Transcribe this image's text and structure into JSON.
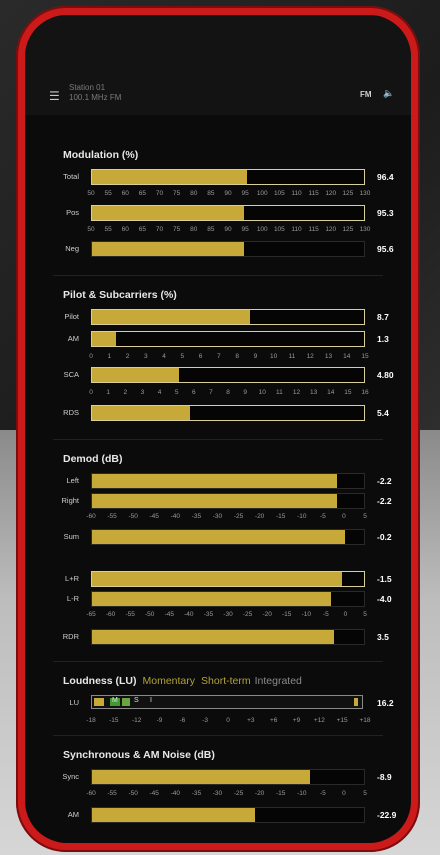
{
  "status": {
    "station_line1": "Station 01",
    "station_line2": "100.1 MHz FM",
    "mode": "FM"
  },
  "sections": {
    "modulation": {
      "title": "Modulation (%)",
      "rows": [
        {
          "label": "Total",
          "value": "96.4",
          "fraction": 0.57
        },
        {
          "label": "Pos",
          "value": "95.3",
          "fraction": 0.56
        },
        {
          "label": "Neg",
          "value": "95.6",
          "fraction": 0.56
        }
      ],
      "scale": [
        "50",
        "55",
        "60",
        "65",
        "70",
        "75",
        "80",
        "85",
        "90",
        "95",
        "100",
        "105",
        "110",
        "115",
        "120",
        "125",
        "130"
      ]
    },
    "pilot": {
      "title": "Pilot & Subcarriers (%)",
      "rows": [
        {
          "label": "Pilot",
          "value": "8.7",
          "fraction": 0.58
        },
        {
          "label": "AM",
          "value": "1.3",
          "fraction": 0.09
        }
      ],
      "scale_a": [
        "0",
        "1",
        "2",
        "3",
        "4",
        "5",
        "6",
        "7",
        "8",
        "9",
        "10",
        "11",
        "12",
        "13",
        "14",
        "15"
      ],
      "rows_b": [
        {
          "label": "SCA",
          "value": "4.80",
          "fraction": 0.32
        }
      ],
      "scale_b": [
        "0",
        "1",
        "2",
        "3",
        "4",
        "5",
        "6",
        "7",
        "8",
        "9",
        "10",
        "11",
        "12",
        "13",
        "14",
        "15",
        "16"
      ],
      "rows_c": [
        {
          "label": "RDS",
          "value": "5.4",
          "fraction": 0.36
        }
      ]
    },
    "demod": {
      "title": "Demod (dB)",
      "rows_a": [
        {
          "label": "Left",
          "value": "-2.2",
          "fraction": 0.9
        },
        {
          "label": "Right",
          "value": "-2.2",
          "fraction": 0.9
        }
      ],
      "scale_a": [
        "-60",
        "-55",
        "-50",
        "-45",
        "-40",
        "-35",
        "-30",
        "-25",
        "-20",
        "-15",
        "-10",
        "-5",
        "0",
        "5"
      ],
      "rows_b": [
        {
          "label": "Sum",
          "value": "-0.2",
          "fraction": 0.93
        }
      ],
      "rows_c": [
        {
          "label": "L+R",
          "value": "-1.5",
          "fraction": 0.92
        },
        {
          "label": "L-R",
          "value": "-4.0",
          "fraction": 0.88
        }
      ],
      "scale_c": [
        "-65",
        "-60",
        "-55",
        "-50",
        "-45",
        "-40",
        "-35",
        "-30",
        "-25",
        "-20",
        "-15",
        "-10",
        "-5",
        "0",
        "5"
      ],
      "rows_d": [
        {
          "label": "RDR",
          "value": "3.5",
          "fraction": 0.89
        }
      ]
    },
    "loudness": {
      "title": "Loudness (LU)",
      "sub_momentary": "Momentary",
      "sub_shortterm": "Short-term",
      "sub_integrated": "Integrated",
      "row": {
        "label": "LU",
        "value": "16.2",
        "m_label": "M",
        "s_label": "S",
        "i_label": "I"
      },
      "scale": [
        "-18",
        "-15",
        "-12",
        "-9",
        "-6",
        "-3",
        "0",
        "+3",
        "+6",
        "+9",
        "+12",
        "+15",
        "+18"
      ]
    },
    "noise": {
      "title": "Synchronous & AM Noise (dB)",
      "rows_a": [
        {
          "label": "Sync",
          "value": "-8.9",
          "fraction": 0.8
        }
      ],
      "scale": [
        "-60",
        "-55",
        "-50",
        "-45",
        "-40",
        "-35",
        "-30",
        "-25",
        "-20",
        "-15",
        "-10",
        "-5",
        "0",
        "5"
      ],
      "rows_b": [
        {
          "label": "AM",
          "value": "-22.9",
          "fraction": 0.6
        }
      ]
    }
  }
}
